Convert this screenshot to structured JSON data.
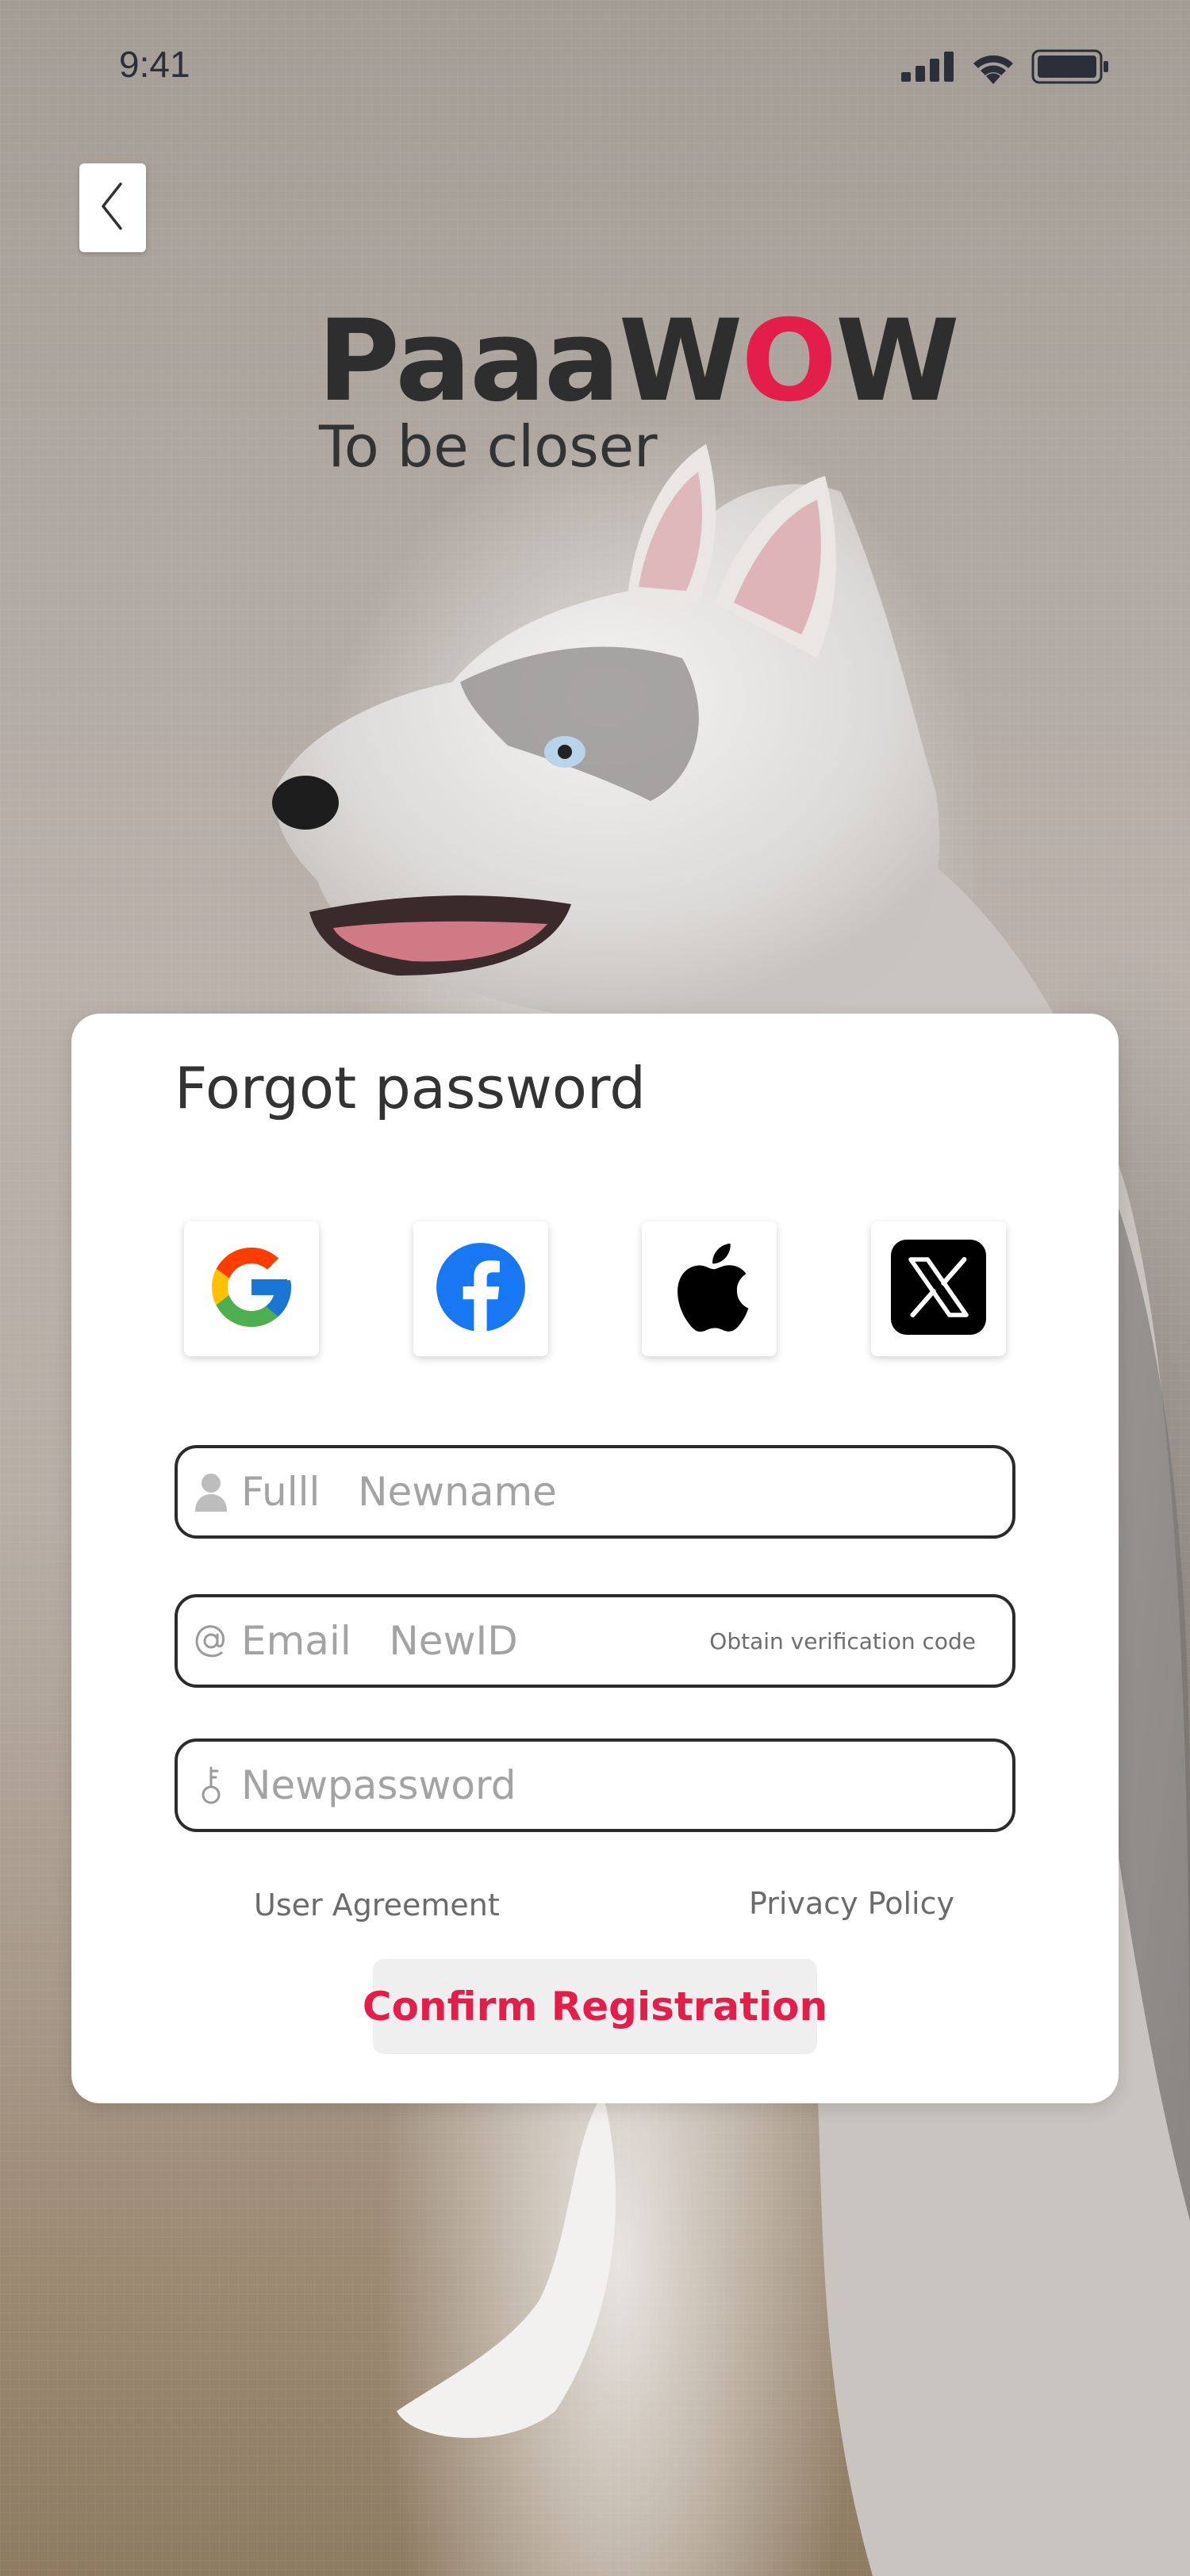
{
  "status_bar": {
    "time": "9:41",
    "icons": [
      "cellular-signal-icon",
      "wifi-icon",
      "battery-icon"
    ]
  },
  "navigation": {
    "back_icon": "chevron-left-icon"
  },
  "brand": {
    "name_part1": "Paaa",
    "name_part2": "W",
    "name_accent": "O",
    "name_part3": "W",
    "tagline": "To be closer",
    "accent_color": "#e41e4a"
  },
  "form": {
    "title": "Forgot password",
    "social_logins": [
      {
        "name": "google",
        "icon": "google-icon"
      },
      {
        "name": "facebook",
        "icon": "facebook-icon"
      },
      {
        "name": "apple",
        "icon": "apple-icon"
      },
      {
        "name": "x",
        "icon": "x-icon"
      }
    ],
    "fields": {
      "full_name": {
        "placeholder": "Fulll   Newname",
        "value": "",
        "icon": "user-icon"
      },
      "email": {
        "placeholder": "Email   NewID",
        "value": "",
        "icon": "at-icon",
        "action_label": "Obtain verification code"
      },
      "password": {
        "placeholder": "Newpassword",
        "value": "",
        "icon": "key-icon"
      }
    },
    "links": {
      "user_agreement": "User Agreement",
      "privacy_policy": "Privacy Policy"
    },
    "submit_label": "Confirm Registration"
  }
}
